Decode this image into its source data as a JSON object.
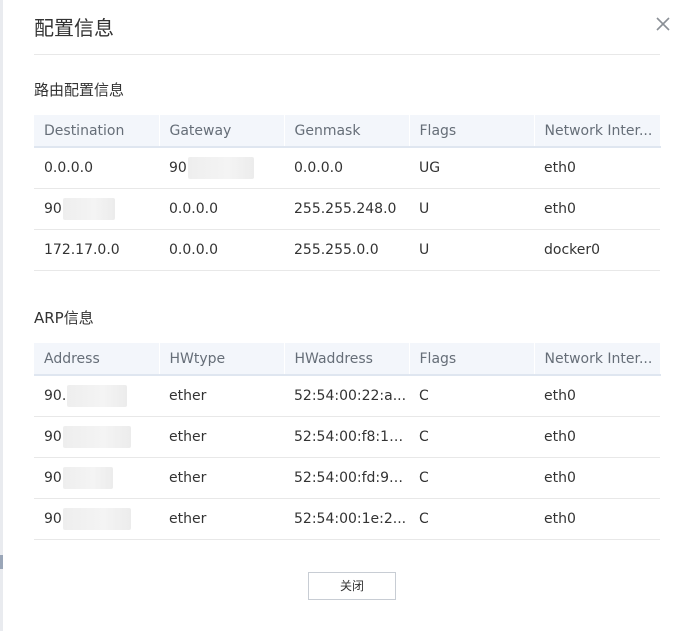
{
  "dialog": {
    "title": "配置信息",
    "close_icon": "close-icon",
    "footer_button": "关闭"
  },
  "route": {
    "section_title": "路由配置信息",
    "columns": [
      "Destination",
      "Gateway",
      "Genmask",
      "Flags",
      "Network Inter..."
    ],
    "rows": [
      {
        "destination": "0.0.0.0",
        "gateway": "90",
        "gateway_masked": true,
        "genmask": "0.0.0.0",
        "flags": "UG",
        "iface": "eth0"
      },
      {
        "destination": "90",
        "destination_masked": true,
        "gateway": "0.0.0.0",
        "genmask": "255.255.248.0",
        "flags": "U",
        "iface": "eth0"
      },
      {
        "destination": "172.17.0.0",
        "gateway": "0.0.0.0",
        "genmask": "255.255.0.0",
        "flags": "U",
        "iface": "docker0"
      }
    ]
  },
  "arp": {
    "section_title": "ARP信息",
    "columns": [
      "Address",
      "HWtype",
      "HWaddress",
      "Flags",
      "Network Inter..."
    ],
    "rows": [
      {
        "address": "90.",
        "hwtype": "ether",
        "hwaddress": "52:54:00:22:a...",
        "flags": "C",
        "iface": "eth0"
      },
      {
        "address": "90",
        "hwtype": "ether",
        "hwaddress": "52:54:00:f8:10...",
        "flags": "C",
        "iface": "eth0"
      },
      {
        "address": "90",
        "hwtype": "ether",
        "hwaddress": "52:54:00:fd:9c...",
        "flags": "C",
        "iface": "eth0"
      },
      {
        "address": "90",
        "hwtype": "ether",
        "hwaddress": "52:54:00:1e:2...",
        "flags": "C",
        "iface": "eth0"
      }
    ]
  },
  "colors": {
    "header_bg": "#f3f6fb",
    "border": "#e8e8e8",
    "text": "#333333"
  }
}
